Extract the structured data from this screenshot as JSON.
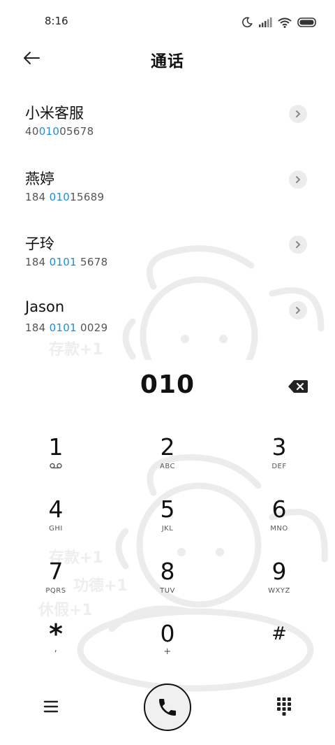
{
  "status": {
    "time": "8:16"
  },
  "header": {
    "title": "通话"
  },
  "contacts": [
    {
      "name": "小米客服",
      "number_pre": "40",
      "number_match": "010",
      "number_post": "05678"
    },
    {
      "name": "燕婷",
      "number_pre": "184 ",
      "number_match": "010",
      "number_post": "15689"
    },
    {
      "name": "子玲",
      "number_pre": "184 ",
      "number_match": "0101",
      "number_post": " 5678"
    },
    {
      "name": "Jason",
      "number_pre": "184 ",
      "number_match": "0101",
      "number_post": " 0029"
    }
  ],
  "dialer": {
    "entered_number": "010",
    "keys": [
      {
        "digit": "1",
        "letters": ""
      },
      {
        "digit": "2",
        "letters": "ABC"
      },
      {
        "digit": "3",
        "letters": "DEF"
      },
      {
        "digit": "4",
        "letters": "GHI"
      },
      {
        "digit": "5",
        "letters": "JKL"
      },
      {
        "digit": "6",
        "letters": "MNO"
      },
      {
        "digit": "7",
        "letters": "PQRS"
      },
      {
        "digit": "8",
        "letters": "TUV"
      },
      {
        "digit": "9",
        "letters": "WXYZ"
      },
      {
        "digit": "*",
        "letters": ","
      },
      {
        "digit": "0",
        "letters": "+"
      },
      {
        "digit": "#",
        "letters": ""
      }
    ]
  },
  "watermark": {
    "text_1": "存款+1",
    "text_2": "存款+1",
    "text_3": "功德+1",
    "text_4": "休假+1"
  },
  "colors": {
    "highlight": "#1a8ed8",
    "background": "#ffffff",
    "watermark": "#eeeeee"
  }
}
